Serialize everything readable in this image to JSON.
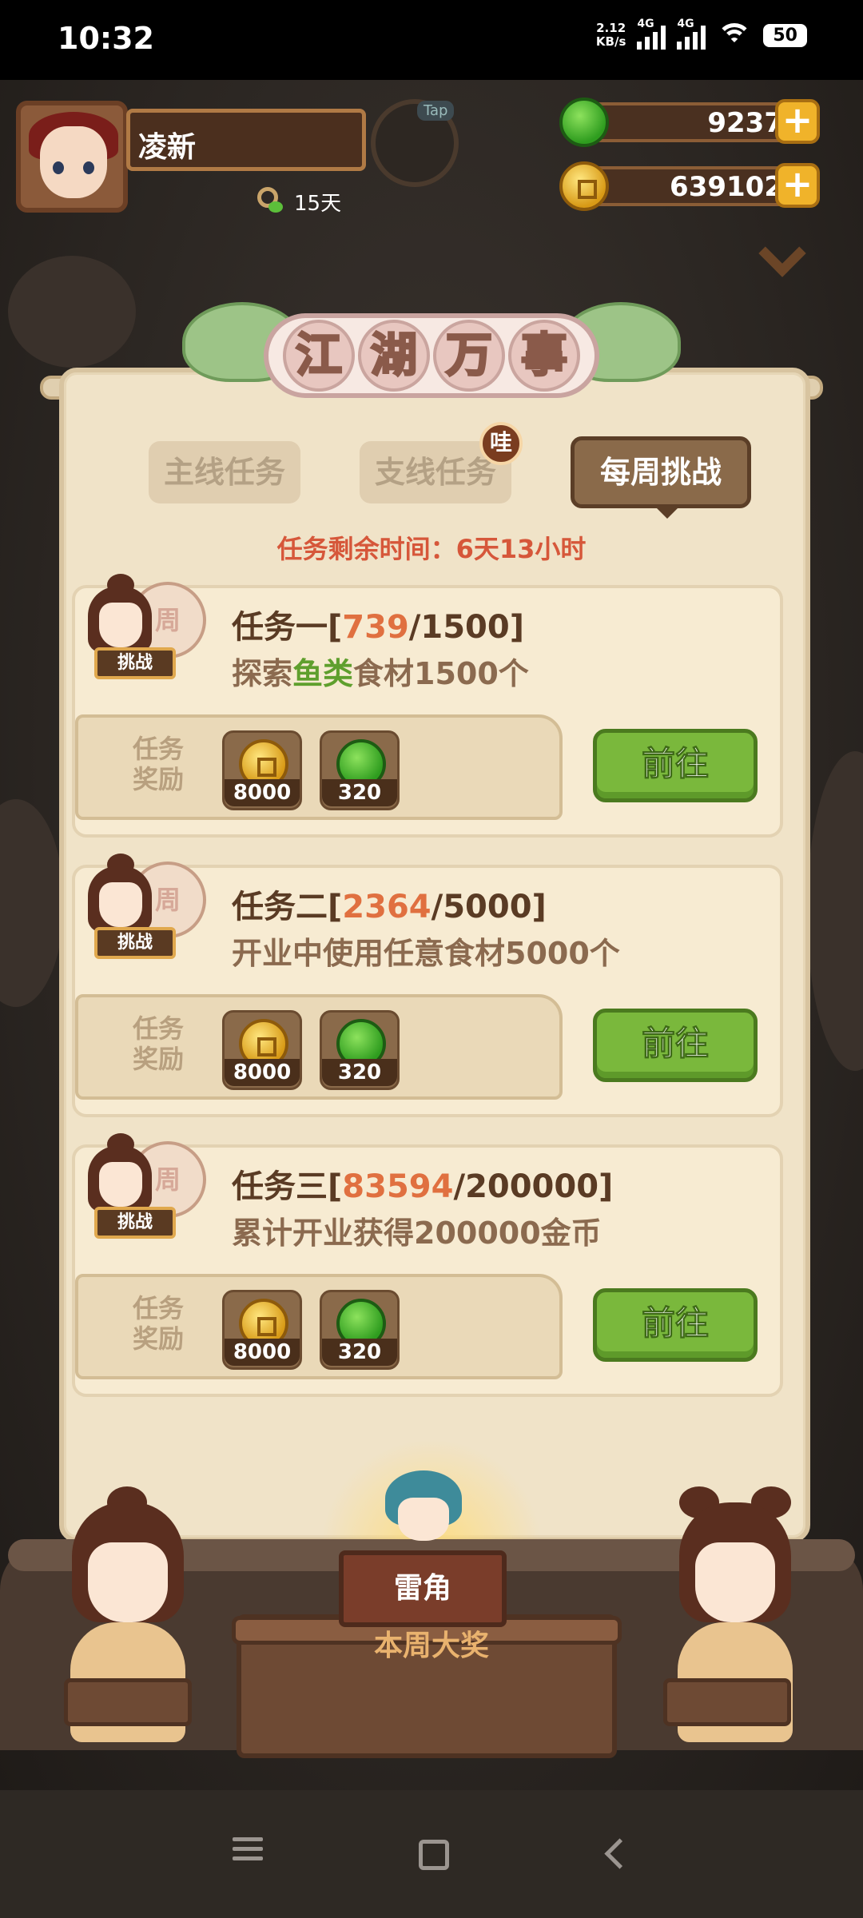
{
  "status_bar": {
    "time": "10:32",
    "net_speed_value": "2.12",
    "net_speed_unit": "KB/s",
    "signal1_label": "4G",
    "signal2_label": "4G",
    "battery": "50"
  },
  "player": {
    "name": "凌新",
    "days": "15天",
    "tap_label": "Tap"
  },
  "currencies": {
    "jade": "9237",
    "gold": "639102"
  },
  "panel": {
    "title_chars": [
      "江",
      "湖",
      "万",
      "事"
    ],
    "tabs": [
      {
        "label": "主线任务"
      },
      {
        "label": "支线任务",
        "badge": "哇"
      },
      {
        "label": "每周挑战"
      }
    ],
    "active_tab": "每周挑战",
    "time_left": "任务剩余时间：6天13小时"
  },
  "tasks": [
    {
      "title_prefix": "任务一[",
      "progress": "739",
      "title_suffix": "/1500]",
      "desc_before": "探索",
      "desc_highlight": "鱼类",
      "desc_after": "食材1500个",
      "plate_char": "周",
      "tag": "挑战",
      "reward_label": "任务奖励",
      "rewards": [
        {
          "icon": "gold-coin-icon",
          "value": "8000"
        },
        {
          "icon": "jade-coin-icon",
          "value": "320"
        }
      ],
      "button": "前往"
    },
    {
      "title_prefix": "任务二[",
      "progress": "2364",
      "title_suffix": "/5000]",
      "desc_before": "开业中使用任意食材5000个",
      "desc_highlight": "",
      "desc_after": "",
      "plate_char": "周",
      "tag": "挑战",
      "reward_label": "任务奖励",
      "rewards": [
        {
          "icon": "gold-coin-icon",
          "value": "8000"
        },
        {
          "icon": "jade-coin-icon",
          "value": "320"
        }
      ],
      "button": "前往"
    },
    {
      "title_prefix": "任务三[",
      "progress": "83594",
      "title_suffix": "/200000]",
      "desc_before": "累计开业获得200000金币",
      "desc_highlight": "",
      "desc_after": "",
      "plate_char": "周",
      "tag": "挑战",
      "reward_label": "任务奖励",
      "rewards": [
        {
          "icon": "gold-coin-icon",
          "value": "8000"
        },
        {
          "icon": "jade-coin-icon",
          "value": "320"
        }
      ],
      "button": "前往"
    }
  ],
  "weekly_prize": {
    "item_name": "雷角",
    "label": "本周大奖"
  },
  "colors": {
    "progress_orange": "#e07040",
    "highlight_green": "#5f9f2d",
    "timer_red": "#d6573a",
    "go_button_green": "#7ab83c"
  }
}
